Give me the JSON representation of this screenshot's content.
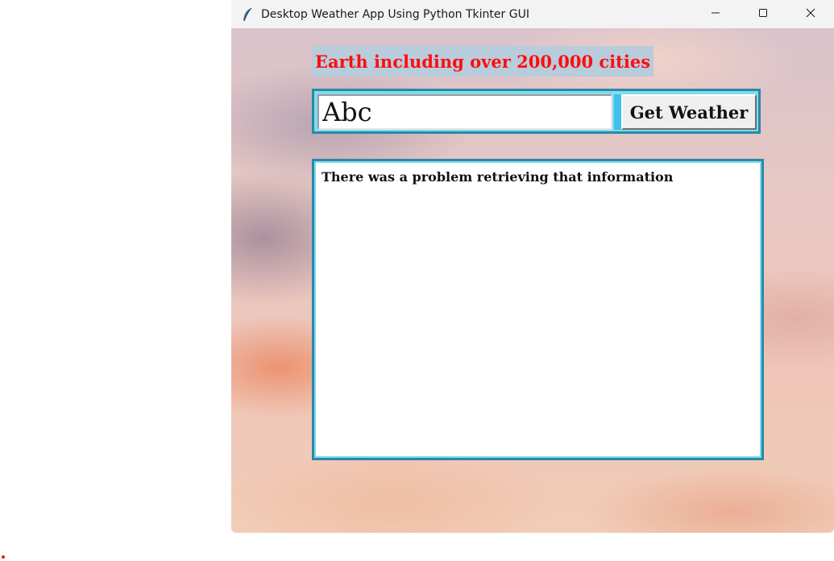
{
  "window": {
    "title": "Desktop Weather App Using Python Tkinter GUI",
    "app_icon": "feather-icon",
    "controls": {
      "minimize_icon": "minimize-icon",
      "maximize_icon": "maximize-icon",
      "close_icon": "close-icon"
    }
  },
  "main": {
    "heading": "Earth including over 200,000 cities",
    "search": {
      "value": "Abc",
      "button_label": "Get Weather"
    },
    "result": {
      "message": "There was a problem retrieving that information"
    }
  },
  "colors": {
    "heading_text": "#ff0d0d",
    "heading_bg": "#b8ccdc",
    "frame_border": "#2a89a8",
    "frame_fill": "#7fdcec",
    "input_accent": "#3fc0ea"
  }
}
